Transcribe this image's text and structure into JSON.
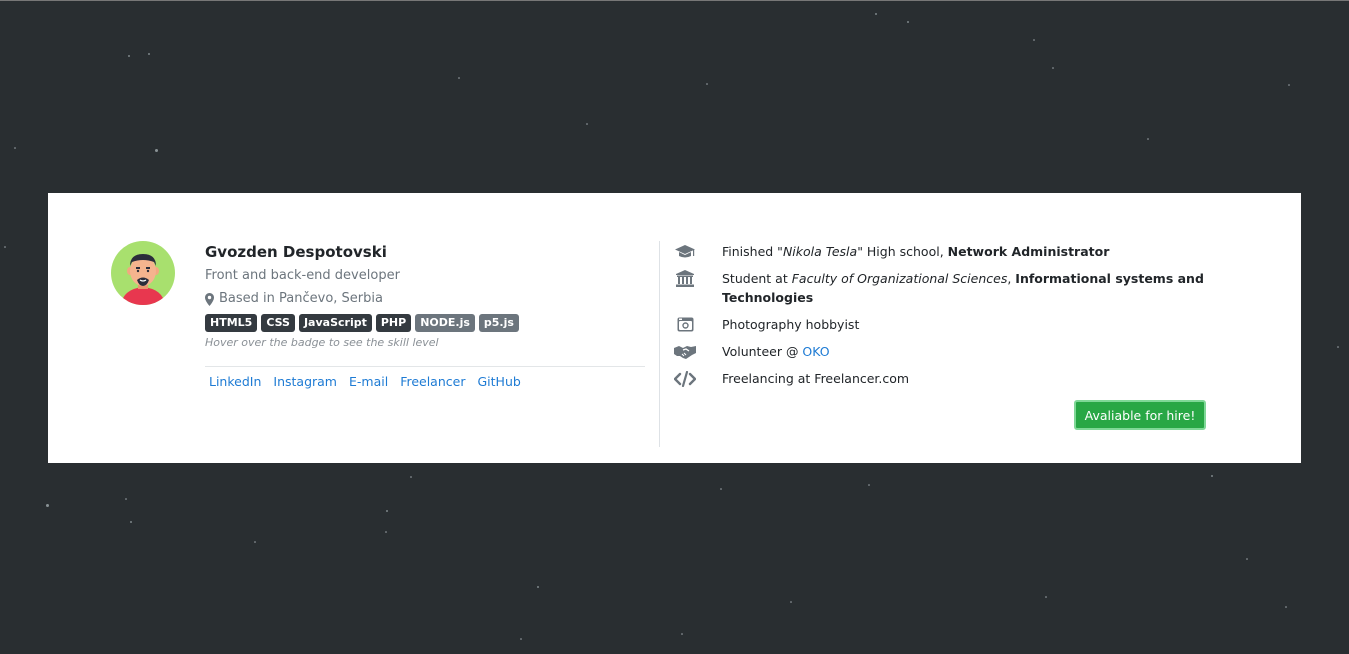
{
  "profile": {
    "name": "Gvozden Despotovski",
    "role": "Front and back-end developer",
    "location": "Based in Pančevo, Serbia",
    "badges": [
      "HTML5",
      "CSS",
      "JavaScript",
      "PHP",
      "NODE.js",
      "p5.js"
    ],
    "hint": "Hover over the badge to see the skill level",
    "links": [
      "LinkedIn",
      "Instagram",
      "E-mail",
      "Freelancer",
      "GitHub"
    ],
    "avatar_colors": {
      "bg": "#a8e06e",
      "shirt": "#e8374f",
      "skin": "#f2a880",
      "hair": "#2b2d3b"
    }
  },
  "details": {
    "education": {
      "icon": "graduation-cap-icon",
      "prefix": "Finished \"",
      "school": "Nikola Tesla",
      "suffix": "\" High school, ",
      "degree": "Network Administrator"
    },
    "university": {
      "icon": "university-icon",
      "prefix": "Student at ",
      "faculty": "Faculty of Organizational Sciences",
      "sep": ", ",
      "program": "Informational systems and Technologies"
    },
    "hobby": {
      "icon": "camera-icon",
      "text": "Photography hobbyist"
    },
    "volunteer": {
      "icon": "handshake-icon",
      "prefix": "Volunteer @ ",
      "org": "OKO"
    },
    "freelance": {
      "icon": "code-icon",
      "text": "Freelancing at Freelancer.com"
    }
  },
  "cta": {
    "label": "Avaliable for hire!"
  },
  "colors": {
    "background": "#292e31",
    "card": "#ffffff",
    "link": "#1e7bd4",
    "badge_dark": "#343a40",
    "badge_secondary": "#6c757d",
    "success": "#28a745"
  }
}
